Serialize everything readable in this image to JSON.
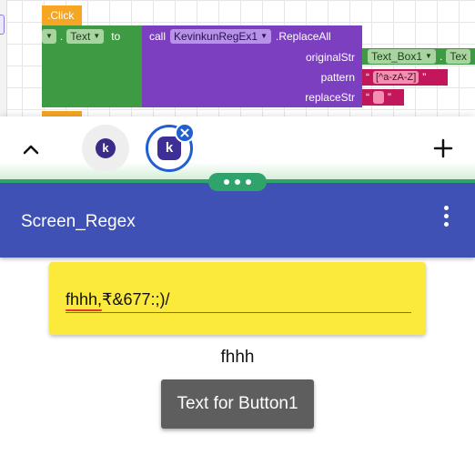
{
  "blocks": {
    "event_label": ".Click",
    "set_component": ".",
    "set_property": "Text",
    "set_to": "to",
    "call_word": "call",
    "call_component": "KevinkunRegEx1",
    "call_method": ".ReplaceAll",
    "param_original": "originalStr",
    "param_pattern": "pattern",
    "param_replace": "replaceStr",
    "original_component": "Text_Box1",
    "original_property": "Tex",
    "pattern_value": "[^a-zA-Z]",
    "quote_open": "“",
    "quote_close": "”",
    "dropdown_arrow": "▼"
  },
  "companion": {
    "collapse_icon": "chevron-up-icon",
    "add_icon": "plus-icon",
    "close_icon": "close-icon",
    "app_letter": "k"
  },
  "app": {
    "screen_title": "Screen_Regex",
    "textbox_value": "fhhh,₹&677:;)/",
    "label_text": "fhhh",
    "button_text": "Text for Button1"
  },
  "colors": {
    "app_bar": "#3f51b5",
    "textbox_bg": "#fbe93b",
    "button_bg": "#5e5e5e",
    "accent_green": "#2fa36b",
    "companion_active": "#1f5fd1"
  }
}
